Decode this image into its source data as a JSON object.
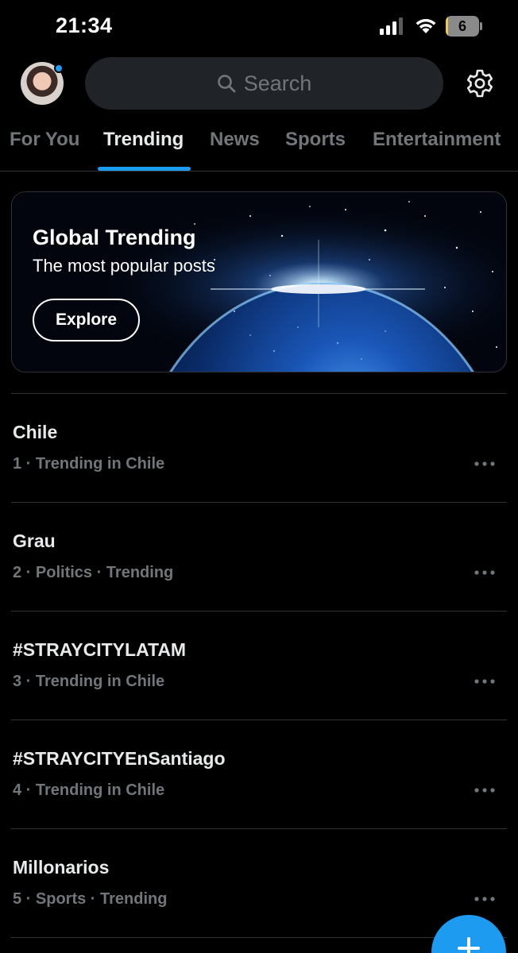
{
  "status_bar": {
    "time": "21:34",
    "battery_level": "6"
  },
  "header": {
    "search_placeholder": "Search"
  },
  "tabs": [
    {
      "label": "For You",
      "active": false
    },
    {
      "label": "Trending",
      "active": true
    },
    {
      "label": "News",
      "active": false
    },
    {
      "label": "Sports",
      "active": false
    },
    {
      "label": "Entertainment",
      "active": false
    }
  ],
  "banner": {
    "title": "Global Trending",
    "subtitle": "The most popular posts",
    "button_label": "Explore"
  },
  "trends": [
    {
      "name": "Chile",
      "meta": "1 · Trending in Chile"
    },
    {
      "name": "Grau",
      "meta": "2 · Politics · Trending"
    },
    {
      "name": "#STRAYCITYLATAM",
      "meta": "3 · Trending in Chile"
    },
    {
      "name": "#STRAYCITYEnSantiago",
      "meta": "4 · Trending in Chile"
    },
    {
      "name": "Millonarios",
      "meta": "5 · Sports · Trending"
    }
  ],
  "icons": {
    "signal": "cellular-signal-icon",
    "wifi": "wifi-icon",
    "battery": "battery-icon",
    "search": "search-icon",
    "settings": "gear-icon",
    "more": "more-horizontal-icon",
    "compose": "plus-icon"
  },
  "colors": {
    "accent": "#1d9bf0",
    "background": "#000000",
    "text_primary": "#e7e9ea",
    "text_secondary": "#71767b",
    "battery_low": "#f2c94c"
  }
}
